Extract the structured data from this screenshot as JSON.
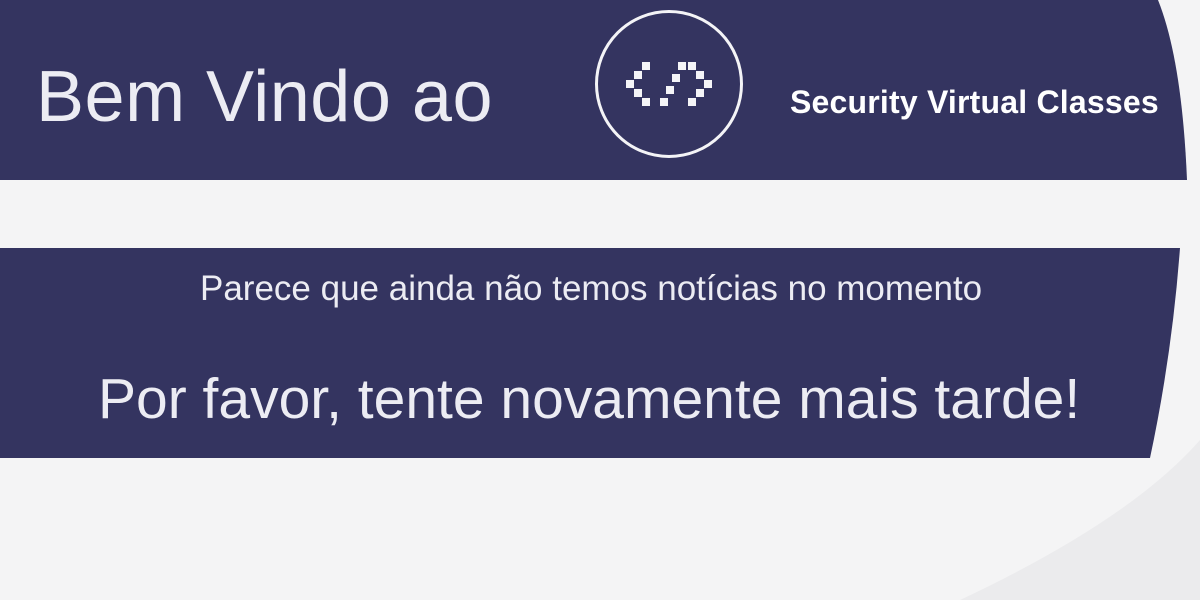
{
  "header": {
    "welcome_text": "Bem Vindo ao",
    "logo_icon": "code-brackets-icon",
    "brand_name": "Security Virtual Classes"
  },
  "news": {
    "message": "Parece que ainda não temos notícias no momento",
    "retry_message": "Por favor, tente novamente mais tarde!"
  },
  "colors": {
    "primary": "#343460",
    "background": "#f4f4f5",
    "text": "#ececf3"
  }
}
